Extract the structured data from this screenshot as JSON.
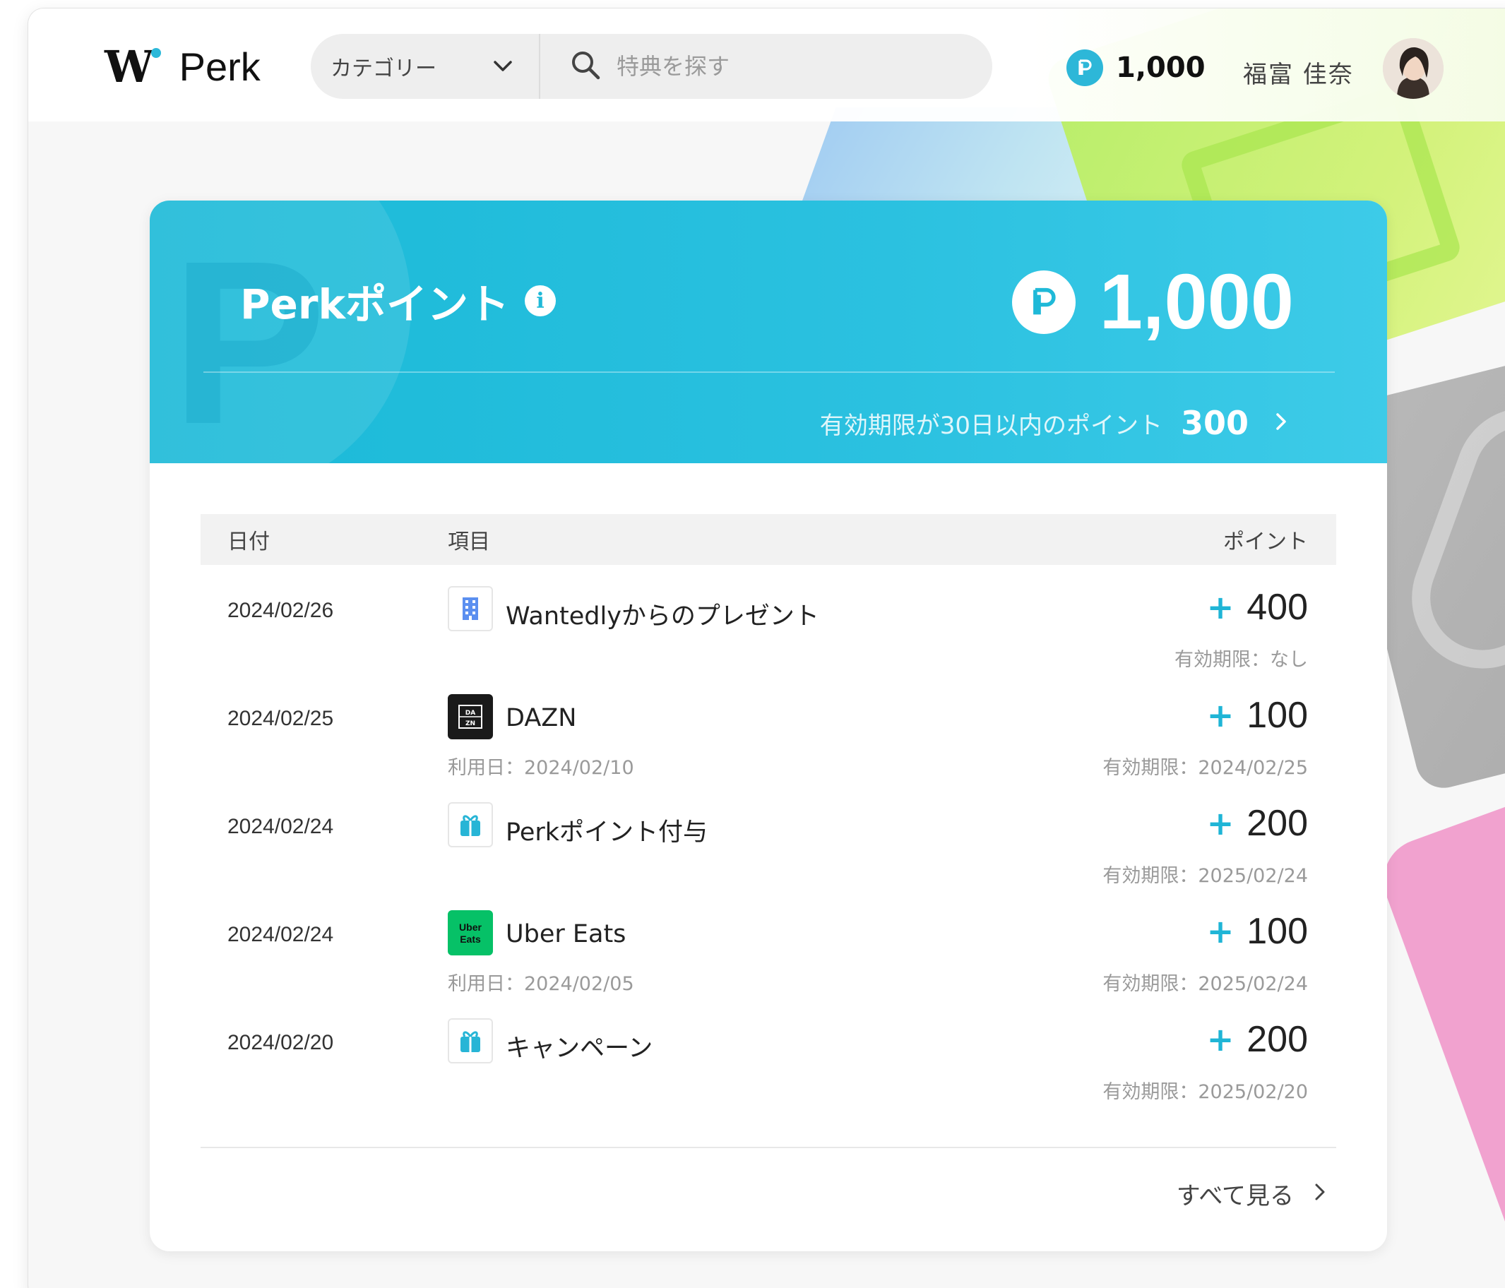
{
  "header": {
    "logo_mark": "W",
    "logo_text": "Perk",
    "category_label": "カテゴリー",
    "search_placeholder": "特典を探す",
    "points": "1,000",
    "username": "福富 佳奈"
  },
  "summary": {
    "title": "Perkポイント",
    "total_points": "1,000",
    "expiring_label": "有効期限が30日以内のポイント",
    "expiring_points": "300"
  },
  "table": {
    "headers": {
      "date": "日付",
      "item": "項目",
      "points": "ポイント"
    },
    "rows": [
      {
        "date": "2024/02/26",
        "icon": "building-icon",
        "name": "Wantedlyからのプレゼント",
        "sub": "",
        "plus": "+",
        "points": "400",
        "expiry": "有効期限：なし"
      },
      {
        "date": "2024/02/25",
        "icon": "dazn-logo-icon",
        "name": "DAZN",
        "sub": "利用日：2024/02/10",
        "plus": "+",
        "points": "100",
        "expiry": "有効期限：2024/02/25"
      },
      {
        "date": "2024/02/24",
        "icon": "gift-icon",
        "name": "Perkポイント付与",
        "sub": "",
        "plus": "+",
        "points": "200",
        "expiry": "有効期限：2025/02/24"
      },
      {
        "date": "2024/02/24",
        "icon": "uber-eats-logo-icon",
        "name": "Uber Eats",
        "sub": "利用日：2024/02/05",
        "plus": "+",
        "points": "100",
        "expiry": "有効期限：2025/02/24"
      },
      {
        "date": "2024/02/20",
        "icon": "gift-icon",
        "name": "キャンペーン",
        "sub": "",
        "plus": "+",
        "points": "200",
        "expiry": "有効期限：2025/02/20"
      }
    ],
    "see_all_label": "すべて見る"
  },
  "logo_texts": {
    "dazn": "DAZN",
    "uber": "Uber Eats"
  },
  "colors": {
    "accent": "#1fb9d8",
    "uber_green": "#06c167",
    "dazn_black": "#1a1a1a"
  }
}
